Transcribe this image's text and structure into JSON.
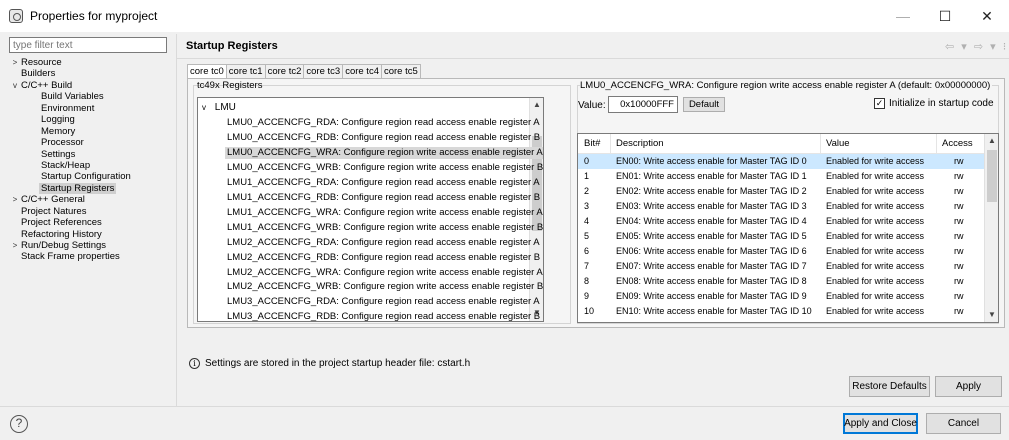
{
  "window": {
    "title": "Properties for myproject",
    "minimize": "—",
    "maximize": "☐",
    "close": "✕"
  },
  "sidebar": {
    "filter_placeholder": "type filter text",
    "tree": [
      {
        "label": "Resource",
        "level": 0,
        "toggle": ">"
      },
      {
        "label": "Builders",
        "level": 0,
        "toggle": ""
      },
      {
        "label": "C/C++ Build",
        "level": 0,
        "toggle": "v"
      },
      {
        "label": "Build Variables",
        "level": 1,
        "toggle": ""
      },
      {
        "label": "Environment",
        "level": 1,
        "toggle": ""
      },
      {
        "label": "Logging",
        "level": 1,
        "toggle": ""
      },
      {
        "label": "Memory",
        "level": 1,
        "toggle": ""
      },
      {
        "label": "Processor",
        "level": 1,
        "toggle": ""
      },
      {
        "label": "Settings",
        "level": 1,
        "toggle": ""
      },
      {
        "label": "Stack/Heap",
        "level": 1,
        "toggle": ""
      },
      {
        "label": "Startup Configuration",
        "level": 1,
        "toggle": ""
      },
      {
        "label": "Startup Registers",
        "level": 1,
        "toggle": "",
        "selected": true
      },
      {
        "label": "C/C++ General",
        "level": 0,
        "toggle": ">"
      },
      {
        "label": "Project Natures",
        "level": 0,
        "toggle": ""
      },
      {
        "label": "Project References",
        "level": 0,
        "toggle": ""
      },
      {
        "label": "Refactoring History",
        "level": 0,
        "toggle": ""
      },
      {
        "label": "Run/Debug Settings",
        "level": 0,
        "toggle": ">"
      },
      {
        "label": "Stack Frame properties",
        "level": 0,
        "toggle": ""
      }
    ]
  },
  "page": {
    "title": "Startup Registers",
    "nav": "⇦ ▾ ⇨ ▾ ⁝",
    "tabs": [
      "core tc0",
      "core tc1",
      "core tc2",
      "core tc3",
      "core tc4",
      "core tc5"
    ],
    "active_tab": 0
  },
  "registers": {
    "group_title": "tc49x Registers",
    "tree_toggle": "v",
    "group_node": "LMU",
    "items": [
      "LMU0_ACCENCFG_RDA: Configure region read access enable register A",
      "LMU0_ACCENCFG_RDB: Configure region read access enable register B",
      "LMU0_ACCENCFG_WRA: Configure region write access enable register A",
      "LMU0_ACCENCFG_WRB: Configure region write access enable register B",
      "LMU1_ACCENCFG_RDA: Configure region read access enable register A",
      "LMU1_ACCENCFG_RDB: Configure region read access enable register B",
      "LMU1_ACCENCFG_WRA: Configure region write access enable register A",
      "LMU1_ACCENCFG_WRB: Configure region write access enable register B",
      "LMU2_ACCENCFG_RDA: Configure region read access enable register A",
      "LMU2_ACCENCFG_RDB: Configure region read access enable register B",
      "LMU2_ACCENCFG_WRA: Configure region write access enable register A",
      "LMU2_ACCENCFG_WRB: Configure region write access enable register B",
      "LMU3_ACCENCFG_RDA: Configure region read access enable register A",
      "LMU3_ACCENCFG_RDB: Configure region read access enable register B"
    ],
    "selected_index": 2
  },
  "detail": {
    "title": "LMU0_ACCENCFG_WRA: Configure region write access enable register A (default: 0x00000000)",
    "value_label": "Value:",
    "value": "0x10000FFF",
    "default_button": "Default",
    "init_checked": "✓",
    "init_label": "Initialize in startup code",
    "columns": [
      "Bit#",
      "Description",
      "Value",
      "Access"
    ],
    "rows": [
      {
        "bit": "0",
        "desc": "EN00: Write access enable for Master TAG ID 0",
        "value": "Enabled for write access",
        "access": "rw"
      },
      {
        "bit": "1",
        "desc": "EN01: Write access enable for Master TAG ID 1",
        "value": "Enabled for write access",
        "access": "rw"
      },
      {
        "bit": "2",
        "desc": "EN02: Write access enable for Master TAG ID 2",
        "value": "Enabled for write access",
        "access": "rw"
      },
      {
        "bit": "3",
        "desc": "EN03: Write access enable for Master TAG ID 3",
        "value": "Enabled for write access",
        "access": "rw"
      },
      {
        "bit": "4",
        "desc": "EN04: Write access enable for Master TAG ID 4",
        "value": "Enabled for write access",
        "access": "rw"
      },
      {
        "bit": "5",
        "desc": "EN05: Write access enable for Master TAG ID 5",
        "value": "Enabled for write access",
        "access": "rw"
      },
      {
        "bit": "6",
        "desc": "EN06: Write access enable for Master TAG ID 6",
        "value": "Enabled for write access",
        "access": "rw"
      },
      {
        "bit": "7",
        "desc": "EN07: Write access enable for Master TAG ID 7",
        "value": "Enabled for write access",
        "access": "rw"
      },
      {
        "bit": "8",
        "desc": "EN08: Write access enable for Master TAG ID 8",
        "value": "Enabled for write access",
        "access": "rw"
      },
      {
        "bit": "9",
        "desc": "EN09: Write access enable for Master TAG ID 9",
        "value": "Enabled for write access",
        "access": "rw"
      },
      {
        "bit": "10",
        "desc": "EN10: Write access enable for Master TAG ID 10",
        "value": "Enabled for write access",
        "access": "rw"
      }
    ],
    "selected_row": 0
  },
  "info": {
    "icon": "i",
    "text": "Settings are stored in the project startup header file: cstart.h"
  },
  "buttons": {
    "restore_defaults": "Restore Defaults",
    "apply": "Apply",
    "apply_and_close": "Apply and Close",
    "cancel": "Cancel",
    "help": "?"
  },
  "colors": {
    "selected_row": "#cce8ff",
    "primary_border": "#0078d7"
  }
}
